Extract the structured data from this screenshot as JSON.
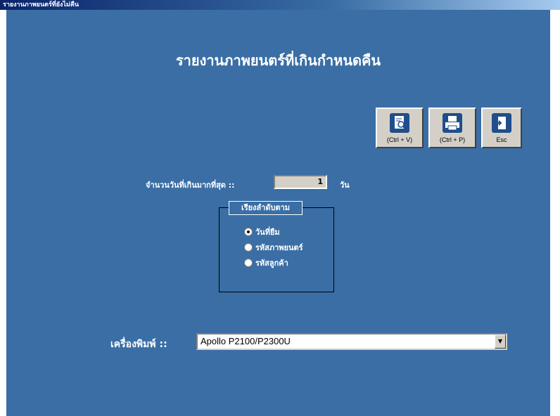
{
  "window": {
    "title": "รายงานภาพยนตร์ที่ยังไม่คืน"
  },
  "form": {
    "heading": "รายงานภาพยนตร์ที่เกินกำหนดคืน"
  },
  "toolbar": {
    "preview_label": "(Ctrl + V)",
    "print_label": "(Ctrl + P)",
    "exit_label": "Esc"
  },
  "days": {
    "label": "จำนวนวันที่เกินมากที่สุด ::",
    "value": "1",
    "unit": "วัน"
  },
  "sort": {
    "title": "เรียงลำดับตาม",
    "options": [
      {
        "label": "วันที่ยืม",
        "selected": true
      },
      {
        "label": "รหัสภาพยนตร์",
        "selected": false
      },
      {
        "label": "รหัสลูกค้า",
        "selected": false
      }
    ]
  },
  "printer": {
    "label": "เครื่องพิมพ์ ::",
    "value": "Apollo P2100/P2300U"
  },
  "colors": {
    "form_background": "#3a6ea5",
    "button_face": "#d4d0c8",
    "icon_blue": "#1f4e8a"
  }
}
